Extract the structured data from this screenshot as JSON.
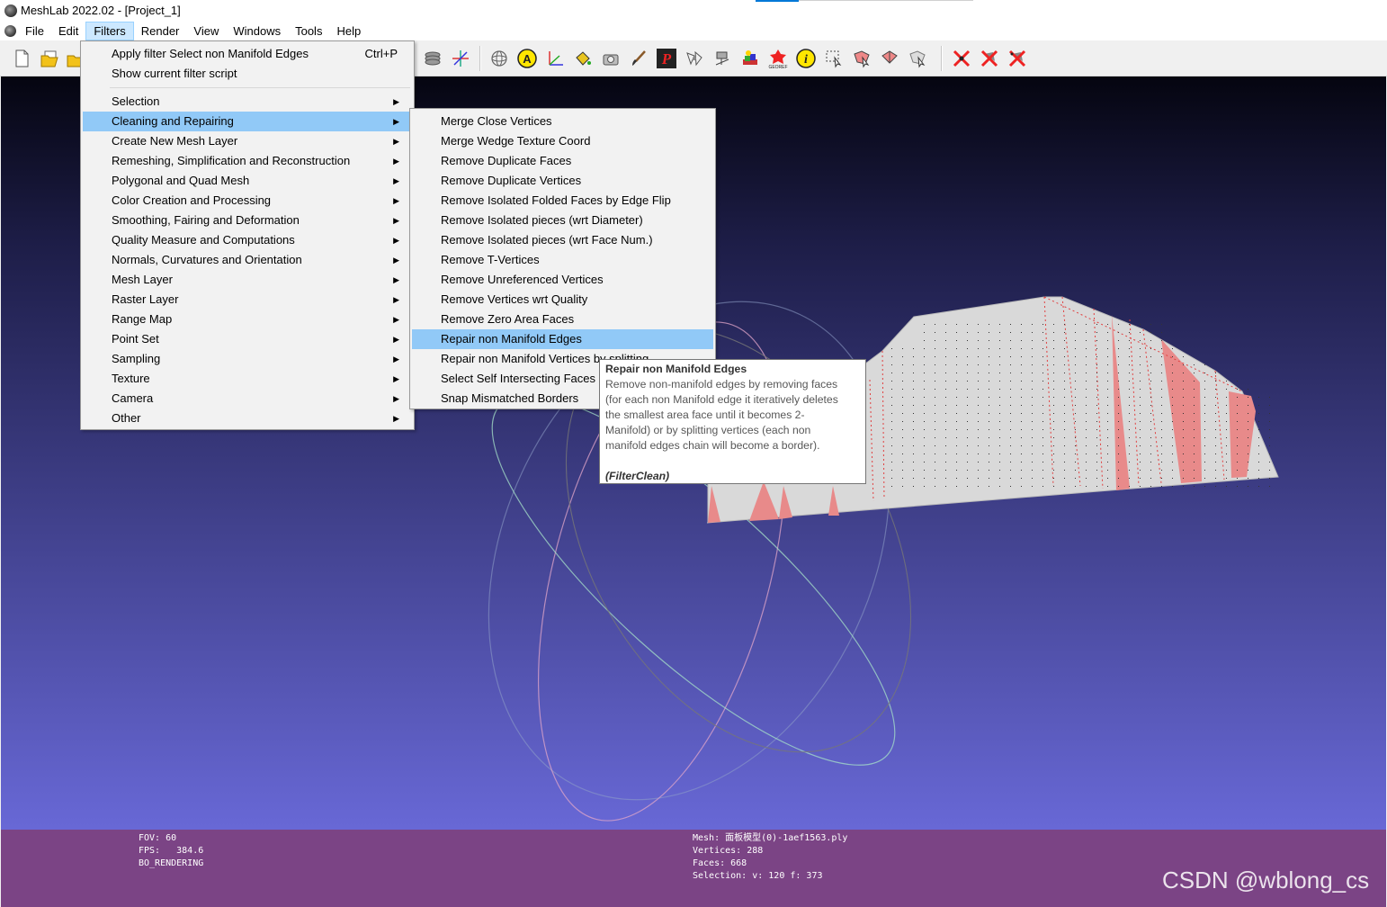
{
  "window": {
    "title": "MeshLab 2022.02 - [Project_1]"
  },
  "menubar": {
    "items": [
      "File",
      "Edit",
      "Filters",
      "Render",
      "View",
      "Windows",
      "Tools",
      "Help"
    ],
    "active": "Filters"
  },
  "filters_menu": {
    "apply_filter": "Apply filter Select non Manifold Edges",
    "apply_shortcut": "Ctrl+P",
    "show_script": "Show current filter script",
    "categories": [
      "Selection",
      "Cleaning and Repairing",
      "Create New Mesh Layer",
      "Remeshing, Simplification and Reconstruction",
      "Polygonal and Quad Mesh",
      "Color Creation and Processing",
      "Smoothing, Fairing and Deformation",
      "Quality Measure and Computations",
      "Normals, Curvatures and Orientation",
      "Mesh Layer",
      "Raster Layer",
      "Range Map",
      "Point Set",
      "Sampling",
      "Texture",
      "Camera",
      "Other"
    ],
    "highlighted": "Cleaning and Repairing"
  },
  "cleaning_submenu": {
    "items": [
      "Merge Close Vertices",
      "Merge Wedge Texture Coord",
      "Remove Duplicate Faces",
      "Remove Duplicate Vertices",
      "Remove Isolated Folded Faces by Edge Flip",
      "Remove Isolated pieces (wrt Diameter)",
      "Remove Isolated pieces (wrt Face Num.)",
      "Remove T-Vertices",
      "Remove Unreferenced Vertices",
      "Remove Vertices wrt Quality",
      "Remove Zero Area Faces",
      "Repair non Manifold Edges",
      "Repair non Manifold Vertices by splitting",
      "Select Self Intersecting Faces",
      "Snap Mismatched Borders"
    ],
    "highlighted": "Repair non Manifold Edges"
  },
  "tooltip": {
    "title": "Repair non Manifold Edges",
    "lines": [
      "Remove non-manifold edges by removing faces",
      "(for each non Manifold edge it iteratively deletes",
      "the smallest area face until it becomes 2-",
      "Manifold) or by splitting vertices (each non",
      "manifold edges chain will become a border)."
    ],
    "filter_class": "(FilterClean)"
  },
  "info_left": {
    "fov": "FOV: 60",
    "fps": "FPS:   384.6",
    "mode": "BO_RENDERING"
  },
  "info_right": {
    "mesh": "Mesh: 面板模型(0)-1aef1563.ply",
    "vertices": "Vertices: 288",
    "faces": "Faces: 668",
    "selection": "Selection: v: 120 f: 373"
  },
  "watermark": "CSDN @wblong_cs",
  "colors": {
    "menu_highlight": "#91c9f7",
    "infobar": "#7b4485",
    "selected_face": "#e88a8a",
    "mesh": "#d8d8d8"
  },
  "toolbar_icons": [
    "new-project-icon",
    "open-project-icon",
    "open-folder-icon",
    "layers-icon",
    "axis-icon",
    "trackball-icon",
    "annotation-a-icon",
    "measure-icon",
    "paint-bucket-icon",
    "camera-icon",
    "brush-icon",
    "pickpoints-icon",
    "align-icon",
    "raster-icon",
    "color-icon",
    "georef-icon",
    "info-icon",
    "select-vertices-icon",
    "select-faces-icon",
    "select-connected-icon",
    "select-pointer-icon",
    "delete-vertices-icon",
    "delete-faces-icon",
    "delete-faces-vertices-icon"
  ]
}
